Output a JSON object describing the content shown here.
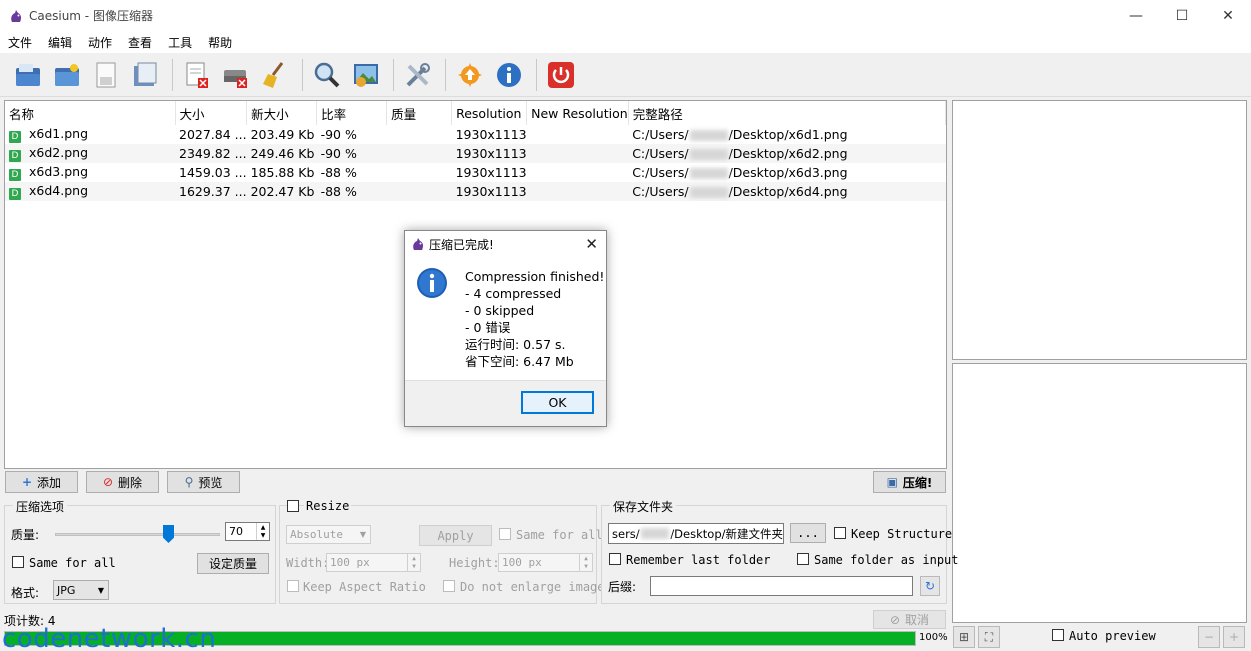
{
  "window": {
    "title": "Caesium - 图像压缩器",
    "controls": {
      "minimize": "—",
      "maximize": "☐",
      "close": "✕"
    }
  },
  "menu": [
    "文件",
    "编辑",
    "动作",
    "查看",
    "工具",
    "帮助"
  ],
  "toolbar": [
    "open-files-icon",
    "open-folder-icon",
    "save-icon",
    "save-as-icon",
    "remove-item-icon",
    "clear-list-icon",
    "clean-icon",
    "preview-icon",
    "image-preview-icon",
    "settings-icon",
    "update-icon",
    "info-icon",
    "exit-icon"
  ],
  "table": {
    "columns": [
      "名称",
      "大小",
      "新大小",
      "比率",
      "质量",
      "Resolution",
      "New Resolution",
      "完整路径"
    ],
    "rows": [
      {
        "name": "x6d1.png",
        "size": "2027.84 ...",
        "new_size": "203.49 Kb",
        "ratio": "-90 %",
        "quality": "",
        "resolution": "1930x1113",
        "new_resolution": "",
        "path_pre": "C:/Users/",
        "path_post": "/Desktop/x6d1.png"
      },
      {
        "name": "x6d2.png",
        "size": "2349.82 ...",
        "new_size": "249.46 Kb",
        "ratio": "-90 %",
        "quality": "",
        "resolution": "1930x1113",
        "new_resolution": "",
        "path_pre": "C:/Users/",
        "path_post": "/Desktop/x6d2.png"
      },
      {
        "name": "x6d3.png",
        "size": "1459.03 ...",
        "new_size": "185.88 Kb",
        "ratio": "-88 %",
        "quality": "",
        "resolution": "1930x1113",
        "new_resolution": "",
        "path_pre": "C:/Users/",
        "path_post": "/Desktop/x6d3.png"
      },
      {
        "name": "x6d4.png",
        "size": "1629.37 ...",
        "new_size": "202.47 Kb",
        "ratio": "-88 %",
        "quality": "",
        "resolution": "1930x1113",
        "new_resolution": "",
        "path_pre": "C:/Users/",
        "path_post": "/Desktop/x6d4.png"
      }
    ]
  },
  "actions": {
    "add": "添加",
    "delete": "删除",
    "preview": "预览",
    "compress": "压缩!"
  },
  "compression": {
    "group_title": "压缩选项",
    "quality_label": "质量:",
    "quality_value": "70",
    "quality_fraction": 0.7,
    "same_for_all": "Same for all",
    "set_quality": "设定质量",
    "format_label": "格式:",
    "format_value": "JPG"
  },
  "resize": {
    "title": "Resize",
    "mode": "Absolute",
    "apply": "Apply",
    "same_for_all": "Same for all",
    "width_label": "Width:",
    "width_value": "100 px",
    "height_label": "Height:",
    "height_value": "100 px",
    "keep_aspect": "Keep Aspect Ratio",
    "no_enlarge": "Do not enlarge images"
  },
  "output": {
    "group_title": "保存文件夹",
    "folder_pre": "sers/",
    "folder_post": "/Desktop/新建文件夹",
    "browse": "...",
    "keep_structure": "Keep Structure",
    "remember_last": "Remember last folder",
    "same_folder": "Same folder as input",
    "suffix_label": "后缀:",
    "suffix_value": ""
  },
  "status": {
    "item_count": "项计数: 4",
    "cancel": "取消",
    "progress_text": "100%",
    "progress_fraction": 1.0
  },
  "preview": {
    "auto_preview": "Auto preview"
  },
  "dialog": {
    "title": "压缩已完成!",
    "lines": [
      "Compression finished!",
      "- 4 compressed",
      "- 0 skipped",
      "- 0 错误",
      "运行时间: 0.57 s.",
      "省下空间: 6.47 Mb"
    ],
    "ok": "OK"
  },
  "watermark": "codenetwork.cn",
  "colors": {
    "progress": "#06b025",
    "accent": "#0078d7",
    "info": "#1e5fb5"
  }
}
